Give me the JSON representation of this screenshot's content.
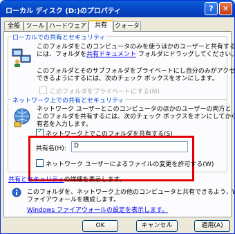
{
  "window": {
    "title": "ローカル ディスク (D:)のプロパティ",
    "help": "?",
    "close": "✕"
  },
  "tabs": [
    "全般",
    "ツール",
    "ハードウェア",
    "共有",
    "クォータ"
  ],
  "local": {
    "title": "ローカルでの共有とセキュリティ",
    "desc1a": "このフォルダをこのコンピュータのみを使うほかのユーザーと共有する",
    "desc1b_pre": "には、フォルダを",
    "desc1b_link": "共有ドキュメント",
    "desc1b_post": " フォルダにドラッグしてください。",
    "desc2a": "このフォルダとそのサブフォルダをプライベートにし自分のみがアクセス",
    "desc2b": "できるようにするには、次のチェック ボックスをオンにします。",
    "private_cb": "このフォルダをプライベートにする(M)"
  },
  "network": {
    "title": "ネットワーク上での共有とセキュリティ",
    "desc1": "ネットワーク ユーザーとこのコンピュータのほかのユーザーの両方と",
    "desc2": "このフォルダを共有するには、次のチェック ボックスをオンにしてから共",
    "desc3": "有名を入力します。",
    "share_cb": "ネットワーク上でこのフォルダを共有する(S)",
    "share_name_label": "共有名(H):",
    "share_name_value": "D",
    "allow_cb": "ネットワーク ユーザーによるファイルの変更を許可する(W)",
    "details_link_pre": "共有とセキュリティ",
    "details_link_post": "の詳細を表示します。"
  },
  "firewall": {
    "info1": "このフォルダを、ネットワーク上の他のコンピュータと共有できるよう、Windows",
    "info2": "ファイアウォールを構成します。",
    "link": "Windows ファイアウォールの設定を表示します。"
  },
  "buttons": {
    "ok": "OK",
    "cancel": "キャンセル",
    "apply": "適用(A)"
  },
  "colors": {
    "highlight": "#e30000",
    "title_bar": "#0847c7"
  }
}
